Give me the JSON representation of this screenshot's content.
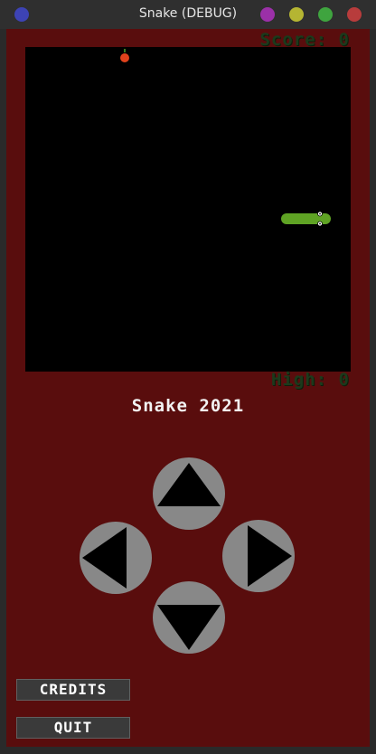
{
  "window": {
    "title": "Snake (DEBUG)",
    "controls": [
      {
        "name": "blue-dot",
        "color": "#3d43b4"
      },
      {
        "name": "purple-dot",
        "color": "#9b30a8"
      },
      {
        "name": "yellow-dot",
        "color": "#b5b532"
      },
      {
        "name": "green-dot",
        "color": "#3fa43f"
      },
      {
        "name": "red-dot",
        "color": "#b83c3c"
      }
    ]
  },
  "game": {
    "score_text": "Score: 0",
    "high_text": "High: 0",
    "title": "Snake 2021"
  },
  "controls": {
    "up_icon": "triangle-up-icon",
    "down_icon": "triangle-down-icon",
    "left_icon": "triangle-left-icon",
    "right_icon": "triangle-right-icon"
  },
  "menu": {
    "credits_label": "CREDITS",
    "quit_label": "QUIT"
  },
  "colors": {
    "background": "#590d0d",
    "playfield": "#000000",
    "snake": "#5fa324",
    "apple": "#e0421c",
    "pad_button": "#888888",
    "text_dim": "#1c3a1c"
  }
}
